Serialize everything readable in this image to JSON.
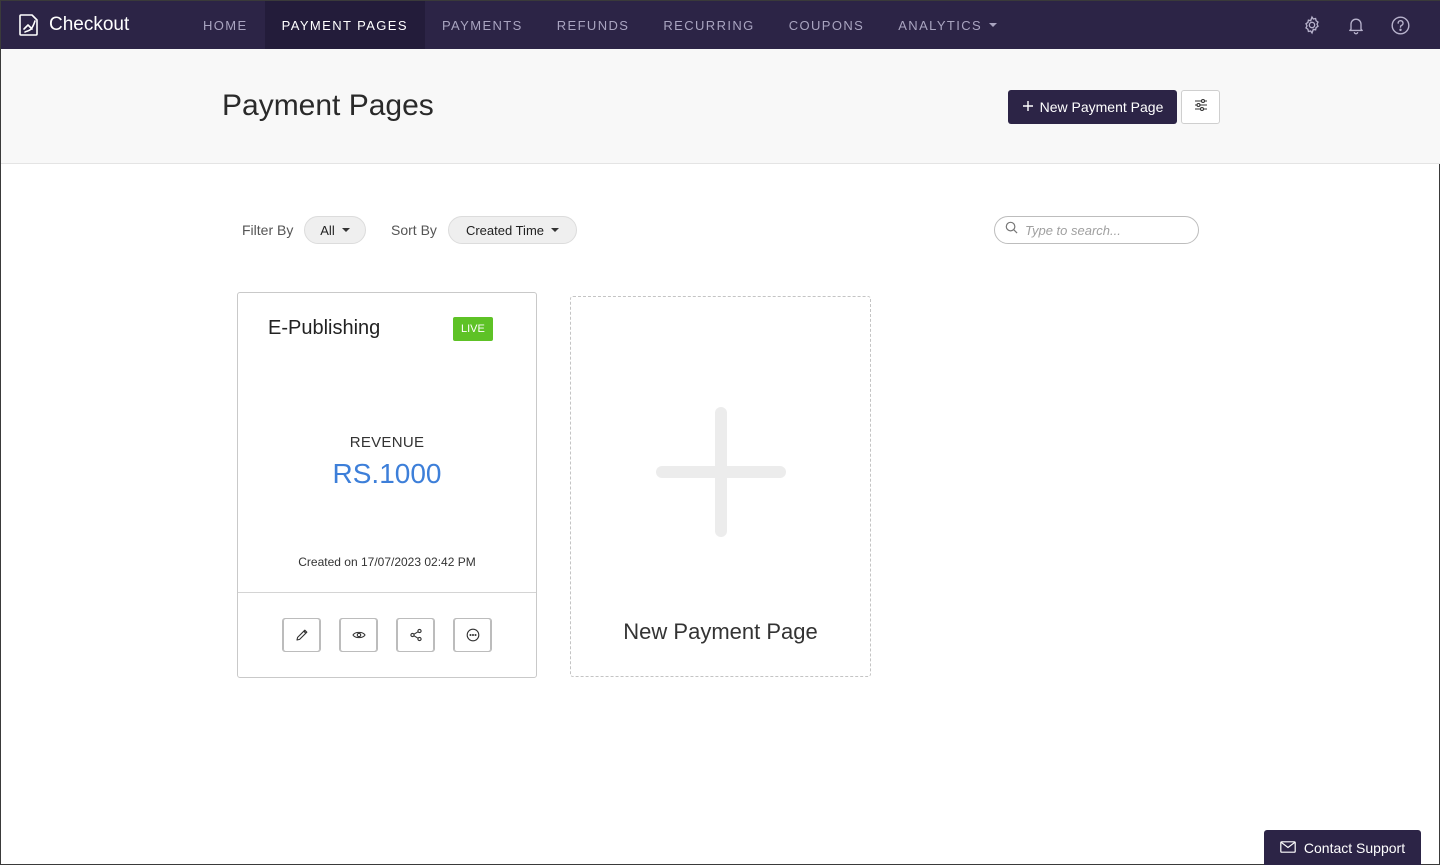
{
  "app": {
    "name": "Checkout"
  },
  "nav": {
    "items": [
      {
        "label": "HOME"
      },
      {
        "label": "PAYMENT PAGES",
        "active": true
      },
      {
        "label": "PAYMENTS"
      },
      {
        "label": "REFUNDS"
      },
      {
        "label": "RECURRING"
      },
      {
        "label": "COUPONS"
      },
      {
        "label": "ANALYTICS",
        "has_dropdown": true
      }
    ],
    "icons": [
      "gear-icon",
      "bell-icon",
      "help-icon"
    ]
  },
  "header": {
    "title": "Payment Pages",
    "new_button_label": "New Payment Page",
    "settings_icon": "sliders-icon"
  },
  "filters": {
    "filter_label": "Filter By",
    "filter_value": "All",
    "sort_label": "Sort By",
    "sort_value": "Created Time",
    "search_placeholder": "Type to search..."
  },
  "cards": [
    {
      "title": "E-Publishing",
      "status": "LIVE",
      "revenue_label": "REVENUE",
      "revenue_value": "RS.1000",
      "created": "Created on 17/07/2023 02:42 PM",
      "actions": [
        "pencil-icon",
        "eye-icon",
        "share-icon",
        "more-icon"
      ]
    }
  ],
  "new_tile": {
    "label": "New Payment Page"
  },
  "support": {
    "label": "Contact Support"
  },
  "colors": {
    "nav_bg": "#2c2446",
    "nav_active_bg": "#231c3a",
    "accent_blue": "#3d7fd9",
    "live_green": "#5ec226"
  }
}
